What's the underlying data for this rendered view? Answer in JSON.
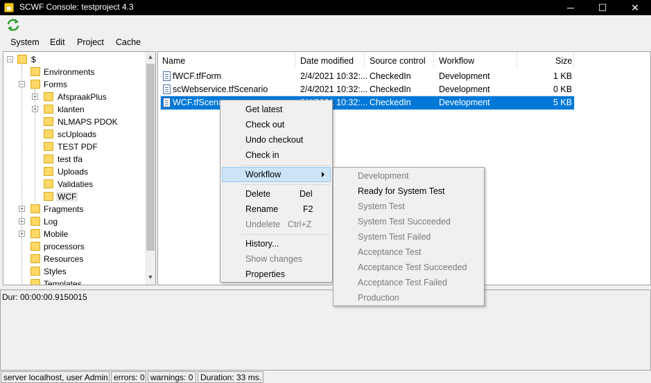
{
  "window": {
    "title": "SCWF Console: testproject 4.3",
    "minimize": "─",
    "maximize": "☐",
    "close": "✕"
  },
  "toolbar": {
    "refresh_icon": "refresh-icon"
  },
  "menubar": {
    "items": [
      "System",
      "Edit",
      "Project",
      "Cache"
    ]
  },
  "tree": {
    "root": "$",
    "items": [
      {
        "label": "Environments"
      },
      {
        "label": "Forms"
      },
      {
        "label": "AfspraakPlus"
      },
      {
        "label": "klanten"
      },
      {
        "label": "NLMAPS PDOK"
      },
      {
        "label": "scUploads"
      },
      {
        "label": "TEST PDF"
      },
      {
        "label": "test tfa"
      },
      {
        "label": "Uploads"
      },
      {
        "label": "Validaties"
      },
      {
        "label": "WCF"
      },
      {
        "label": "Fragments"
      },
      {
        "label": "Log"
      },
      {
        "label": "Mobile"
      },
      {
        "label": "processors"
      },
      {
        "label": "Resources"
      },
      {
        "label": "Styles"
      },
      {
        "label": "Templates"
      }
    ]
  },
  "list": {
    "columns": [
      "Name",
      "Date modified",
      "Source control",
      "Workflow",
      "Size"
    ],
    "rows": [
      {
        "name": "fWCF.tfForm",
        "date": "2/4/2021 10:32:...",
        "source": "CheckedIn",
        "workflow": "Development",
        "size": "1 KB"
      },
      {
        "name": "scWebservice.tfScenario",
        "date": "2/4/2021 10:32:...",
        "source": "CheckedIn",
        "workflow": "Development",
        "size": "0 KB"
      },
      {
        "name": "WCF.tfScena",
        "date": "2/4/2021 10:32:...",
        "source": "CheckedIn",
        "workflow": "Development",
        "size": "5 KB"
      }
    ]
  },
  "context_menu": {
    "items": [
      {
        "label": "Get latest",
        "shortcut": ""
      },
      {
        "label": "Check out",
        "shortcut": ""
      },
      {
        "label": "Undo checkout",
        "shortcut": ""
      },
      {
        "label": "Check in",
        "shortcut": ""
      },
      {
        "label": "Workflow",
        "shortcut": ""
      },
      {
        "label": "Delete",
        "shortcut": "Del"
      },
      {
        "label": "Rename",
        "shortcut": "F2"
      },
      {
        "label": "Undelete",
        "shortcut": "Ctrl+Z"
      },
      {
        "label": "History...",
        "shortcut": ""
      },
      {
        "label": "Show changes",
        "shortcut": ""
      },
      {
        "label": "Properties",
        "shortcut": ""
      }
    ]
  },
  "workflow_submenu": {
    "items": [
      "Development",
      "Ready for System Test",
      "System Test",
      "System Test Succeeded",
      "System Test Failed",
      "Acceptance Test",
      "Acceptance Test Succeeded",
      "Acceptance Test Failed",
      "Production"
    ]
  },
  "log": {
    "text": "Dur: 00:00:00.9150015"
  },
  "statusbar": {
    "server": "server localhost, user Admin",
    "errors": "errors: 0",
    "warnings": "warnings: 0",
    "duration": "Duration: 33 ms."
  },
  "colors": {
    "selection": "#0078d7",
    "hover": "#cce4f7",
    "folder": "#ffd866"
  }
}
